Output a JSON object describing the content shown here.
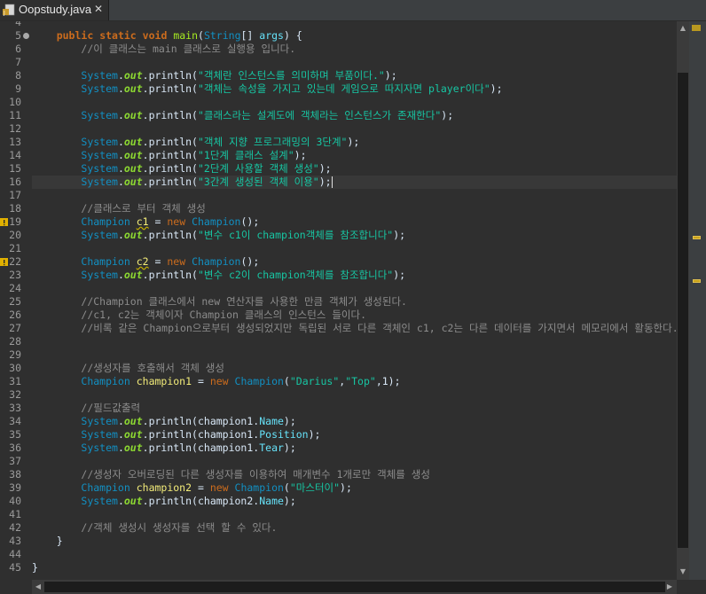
{
  "tab": {
    "filename": "Oopstudy.java",
    "close_label": "✕"
  },
  "colors": {
    "background": "#2f2f2f",
    "keyword": "#cc6c1d",
    "type": "#1290c3",
    "string": "#17c6a3",
    "comment": "#8c8c8c",
    "method": "#a7ec21"
  },
  "editor": {
    "lines": [
      {
        "n": "4",
        "t": []
      },
      {
        "n": "5",
        "fold": true,
        "t": [
          [
            "    ",
            ""
          ],
          [
            "public",
            "kw"
          ],
          [
            " ",
            ""
          ],
          [
            "static",
            "kw"
          ],
          [
            " ",
            ""
          ],
          [
            "void",
            "kw"
          ],
          [
            " ",
            ""
          ],
          [
            "main",
            "fn"
          ],
          [
            "(",
            "pl"
          ],
          [
            "String",
            "ty"
          ],
          [
            "[] ",
            "pl"
          ],
          [
            "args",
            "fld"
          ],
          [
            ") {",
            "pl"
          ]
        ]
      },
      {
        "n": "6",
        "t": [
          [
            "        ",
            ""
          ],
          [
            "//이 클래스는 main 클래스로 실행용 입니다.",
            "cm"
          ]
        ]
      },
      {
        "n": "7",
        "t": []
      },
      {
        "n": "8",
        "t": [
          [
            "        ",
            ""
          ],
          [
            "System",
            "sys"
          ],
          [
            ".",
            "pl"
          ],
          [
            "out",
            "out"
          ],
          [
            ".println(",
            "pl"
          ],
          [
            "\"객체란 인스턴스를 의미하며 부품이다.\"",
            "st"
          ],
          [
            ");",
            "pl"
          ]
        ]
      },
      {
        "n": "9",
        "t": [
          [
            "        ",
            ""
          ],
          [
            "System",
            "sys"
          ],
          [
            ".",
            "pl"
          ],
          [
            "out",
            "out"
          ],
          [
            ".println(",
            "pl"
          ],
          [
            "\"객체는 속성을 가지고 있는데 게임으로 따지자면 player이다\"",
            "st"
          ],
          [
            ");",
            "pl"
          ]
        ]
      },
      {
        "n": "10",
        "t": []
      },
      {
        "n": "11",
        "t": [
          [
            "        ",
            ""
          ],
          [
            "System",
            "sys"
          ],
          [
            ".",
            "pl"
          ],
          [
            "out",
            "out"
          ],
          [
            ".println(",
            "pl"
          ],
          [
            "\"클래스라는 설계도에 객체라는 인스턴스가 존재한다\"",
            "st"
          ],
          [
            ");",
            "pl"
          ]
        ]
      },
      {
        "n": "12",
        "t": []
      },
      {
        "n": "13",
        "t": [
          [
            "        ",
            ""
          ],
          [
            "System",
            "sys"
          ],
          [
            ".",
            "pl"
          ],
          [
            "out",
            "out"
          ],
          [
            ".println(",
            "pl"
          ],
          [
            "\"객체 지향 프로그래밍의 3단계\"",
            "st"
          ],
          [
            ");",
            "pl"
          ]
        ]
      },
      {
        "n": "14",
        "t": [
          [
            "        ",
            ""
          ],
          [
            "System",
            "sys"
          ],
          [
            ".",
            "pl"
          ],
          [
            "out",
            "out"
          ],
          [
            ".println(",
            "pl"
          ],
          [
            "\"1단계 클래스 설계\"",
            "st"
          ],
          [
            ");",
            "pl"
          ]
        ]
      },
      {
        "n": "15",
        "t": [
          [
            "        ",
            ""
          ],
          [
            "System",
            "sys"
          ],
          [
            ".",
            "pl"
          ],
          [
            "out",
            "out"
          ],
          [
            ".println(",
            "pl"
          ],
          [
            "\"2단계 사용할 객체 생성\"",
            "st"
          ],
          [
            ");",
            "pl"
          ]
        ]
      },
      {
        "n": "16",
        "hl": true,
        "cursor": true,
        "t": [
          [
            "        ",
            ""
          ],
          [
            "System",
            "sys"
          ],
          [
            ".",
            "pl"
          ],
          [
            "out",
            "out"
          ],
          [
            ".println(",
            "pl"
          ],
          [
            "\"3간계 생성된 객체 이용\"",
            "st"
          ],
          [
            ");",
            "pl"
          ]
        ]
      },
      {
        "n": "17",
        "t": []
      },
      {
        "n": "18",
        "t": [
          [
            "        ",
            ""
          ],
          [
            "//클래스로 부터 객체 생성",
            "cm"
          ]
        ]
      },
      {
        "n": "19",
        "warn": true,
        "t": [
          [
            "        ",
            ""
          ],
          [
            "Champion",
            "ty"
          ],
          [
            " ",
            ""
          ],
          [
            "c1",
            "var-u"
          ],
          [
            " = ",
            "pl"
          ],
          [
            "new",
            "kwn"
          ],
          [
            " ",
            ""
          ],
          [
            "Champion",
            "ty"
          ],
          [
            "();",
            "pl"
          ]
        ]
      },
      {
        "n": "20",
        "t": [
          [
            "        ",
            ""
          ],
          [
            "System",
            "sys"
          ],
          [
            ".",
            "pl"
          ],
          [
            "out",
            "out"
          ],
          [
            ".println(",
            "pl"
          ],
          [
            "\"변수 c1이 champion객체를 참조합니다\"",
            "st"
          ],
          [
            ");",
            "pl"
          ]
        ]
      },
      {
        "n": "21",
        "t": []
      },
      {
        "n": "22",
        "warn": true,
        "t": [
          [
            "        ",
            ""
          ],
          [
            "Champion",
            "ty"
          ],
          [
            " ",
            ""
          ],
          [
            "c2",
            "var-u"
          ],
          [
            " = ",
            "pl"
          ],
          [
            "new",
            "kwn"
          ],
          [
            " ",
            ""
          ],
          [
            "Champion",
            "ty"
          ],
          [
            "();",
            "pl"
          ]
        ]
      },
      {
        "n": "23",
        "t": [
          [
            "        ",
            ""
          ],
          [
            "System",
            "sys"
          ],
          [
            ".",
            "pl"
          ],
          [
            "out",
            "out"
          ],
          [
            ".println(",
            "pl"
          ],
          [
            "\"변수 c2이 champion객체를 참조합니다\"",
            "st"
          ],
          [
            ");",
            "pl"
          ]
        ]
      },
      {
        "n": "24",
        "t": []
      },
      {
        "n": "25",
        "t": [
          [
            "        ",
            ""
          ],
          [
            "//Champion 클래스에서 new 연산자를 사용한 만큼 객체가 생성된다.",
            "cm"
          ]
        ]
      },
      {
        "n": "26",
        "t": [
          [
            "        ",
            ""
          ],
          [
            "//c1, c2는 객체이자 Champion 클래스의 인스턴스 들이다.",
            "cm"
          ]
        ]
      },
      {
        "n": "27",
        "t": [
          [
            "        ",
            ""
          ],
          [
            "//비록 같은 Champion으로부터 생성되었지만 독립된 서로 다른 객체인 c1, c2는 다른 데이터를 가지면서 메모리에서 활동한다.",
            "cm"
          ]
        ]
      },
      {
        "n": "28",
        "t": []
      },
      {
        "n": "29",
        "t": []
      },
      {
        "n": "30",
        "t": [
          [
            "        ",
            ""
          ],
          [
            "//생성자를 호출해서 객체 생성",
            "cm"
          ]
        ]
      },
      {
        "n": "31",
        "t": [
          [
            "        ",
            ""
          ],
          [
            "Champion",
            "ty"
          ],
          [
            " ",
            ""
          ],
          [
            "champion1",
            "var"
          ],
          [
            " = ",
            "pl"
          ],
          [
            "new",
            "kwn"
          ],
          [
            " ",
            ""
          ],
          [
            "Champion",
            "ty"
          ],
          [
            "(",
            "pl"
          ],
          [
            "\"Darius\"",
            "st"
          ],
          [
            ",",
            "pl"
          ],
          [
            "\"Top\"",
            "st"
          ],
          [
            ",1);",
            "pl"
          ]
        ]
      },
      {
        "n": "32",
        "t": []
      },
      {
        "n": "33",
        "t": [
          [
            "        ",
            ""
          ],
          [
            "//필드값출력",
            "cm"
          ]
        ]
      },
      {
        "n": "34",
        "t": [
          [
            "        ",
            ""
          ],
          [
            "System",
            "sys"
          ],
          [
            ".",
            "pl"
          ],
          [
            "out",
            "out"
          ],
          [
            ".println(champion1.",
            "pl"
          ],
          [
            "Name",
            "fld"
          ],
          [
            ");",
            "pl"
          ]
        ]
      },
      {
        "n": "35",
        "t": [
          [
            "        ",
            ""
          ],
          [
            "System",
            "sys"
          ],
          [
            ".",
            "pl"
          ],
          [
            "out",
            "out"
          ],
          [
            ".println(champion1.",
            "pl"
          ],
          [
            "Position",
            "fld"
          ],
          [
            ");",
            "pl"
          ]
        ]
      },
      {
        "n": "36",
        "t": [
          [
            "        ",
            ""
          ],
          [
            "System",
            "sys"
          ],
          [
            ".",
            "pl"
          ],
          [
            "out",
            "out"
          ],
          [
            ".println(champion1.",
            "pl"
          ],
          [
            "Tear",
            "fld"
          ],
          [
            ");",
            "pl"
          ]
        ]
      },
      {
        "n": "37",
        "t": []
      },
      {
        "n": "38",
        "t": [
          [
            "        ",
            ""
          ],
          [
            "//생성자 오버로딩된 다른 생성자를 이용하여 매개변수 1개로만 객체를 생성",
            "cm"
          ]
        ]
      },
      {
        "n": "39",
        "t": [
          [
            "        ",
            ""
          ],
          [
            "Champion",
            "ty"
          ],
          [
            " ",
            ""
          ],
          [
            "champion2",
            "var"
          ],
          [
            " = ",
            "pl"
          ],
          [
            "new",
            "kwn"
          ],
          [
            " ",
            ""
          ],
          [
            "Champion",
            "ty"
          ],
          [
            "(",
            "pl"
          ],
          [
            "\"마스터이\"",
            "st"
          ],
          [
            ");",
            "pl"
          ]
        ]
      },
      {
        "n": "40",
        "t": [
          [
            "        ",
            ""
          ],
          [
            "System",
            "sys"
          ],
          [
            ".",
            "pl"
          ],
          [
            "out",
            "out"
          ],
          [
            ".println(champion2.",
            "pl"
          ],
          [
            "Name",
            "fld"
          ],
          [
            ");",
            "pl"
          ]
        ]
      },
      {
        "n": "41",
        "t": []
      },
      {
        "n": "42",
        "t": [
          [
            "        ",
            ""
          ],
          [
            "//객체 생성시 생성자를 선택 할 수 있다.",
            "cm"
          ]
        ]
      },
      {
        "n": "43",
        "t": [
          [
            "    ",
            ""
          ],
          [
            "}",
            "pl"
          ]
        ]
      },
      {
        "n": "44",
        "t": []
      },
      {
        "n": "45",
        "t": [
          [
            "}",
            "pl"
          ]
        ]
      }
    ]
  },
  "scrollbars": {
    "up_arrow": "▲",
    "down_arrow": "▼",
    "left_arrow": "◀",
    "right_arrow": "▶"
  },
  "overview_marks": [
    {
      "line": "19"
    },
    {
      "line": "22"
    }
  ]
}
